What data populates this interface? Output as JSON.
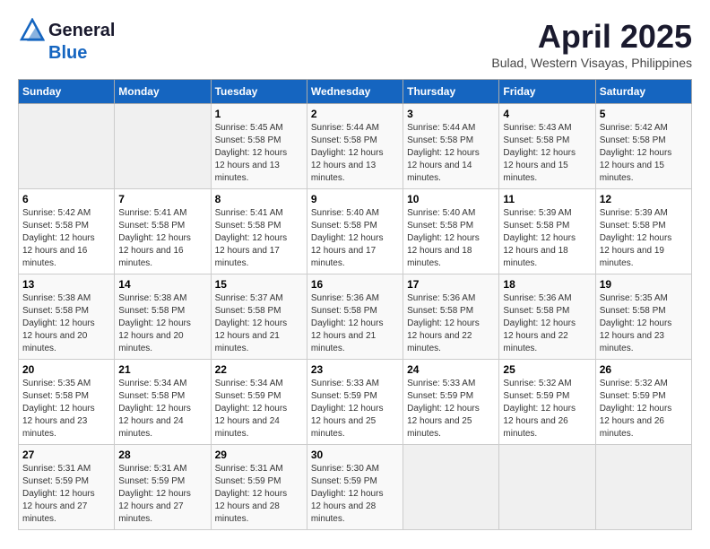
{
  "header": {
    "logo_general": "General",
    "logo_blue": "Blue",
    "month_title": "April 2025",
    "location": "Bulad, Western Visayas, Philippines"
  },
  "weekdays": [
    "Sunday",
    "Monday",
    "Tuesday",
    "Wednesday",
    "Thursday",
    "Friday",
    "Saturday"
  ],
  "weeks": [
    [
      {
        "day": "",
        "empty": true
      },
      {
        "day": "",
        "empty": true
      },
      {
        "day": "1",
        "sunrise": "5:45 AM",
        "sunset": "5:58 PM",
        "daylight": "12 hours and 13 minutes."
      },
      {
        "day": "2",
        "sunrise": "5:44 AM",
        "sunset": "5:58 PM",
        "daylight": "12 hours and 13 minutes."
      },
      {
        "day": "3",
        "sunrise": "5:44 AM",
        "sunset": "5:58 PM",
        "daylight": "12 hours and 14 minutes."
      },
      {
        "day": "4",
        "sunrise": "5:43 AM",
        "sunset": "5:58 PM",
        "daylight": "12 hours and 15 minutes."
      },
      {
        "day": "5",
        "sunrise": "5:42 AM",
        "sunset": "5:58 PM",
        "daylight": "12 hours and 15 minutes."
      }
    ],
    [
      {
        "day": "6",
        "sunrise": "5:42 AM",
        "sunset": "5:58 PM",
        "daylight": "12 hours and 16 minutes."
      },
      {
        "day": "7",
        "sunrise": "5:41 AM",
        "sunset": "5:58 PM",
        "daylight": "12 hours and 16 minutes."
      },
      {
        "day": "8",
        "sunrise": "5:41 AM",
        "sunset": "5:58 PM",
        "daylight": "12 hours and 17 minutes."
      },
      {
        "day": "9",
        "sunrise": "5:40 AM",
        "sunset": "5:58 PM",
        "daylight": "12 hours and 17 minutes."
      },
      {
        "day": "10",
        "sunrise": "5:40 AM",
        "sunset": "5:58 PM",
        "daylight": "12 hours and 18 minutes."
      },
      {
        "day": "11",
        "sunrise": "5:39 AM",
        "sunset": "5:58 PM",
        "daylight": "12 hours and 18 minutes."
      },
      {
        "day": "12",
        "sunrise": "5:39 AM",
        "sunset": "5:58 PM",
        "daylight": "12 hours and 19 minutes."
      }
    ],
    [
      {
        "day": "13",
        "sunrise": "5:38 AM",
        "sunset": "5:58 PM",
        "daylight": "12 hours and 20 minutes."
      },
      {
        "day": "14",
        "sunrise": "5:38 AM",
        "sunset": "5:58 PM",
        "daylight": "12 hours and 20 minutes."
      },
      {
        "day": "15",
        "sunrise": "5:37 AM",
        "sunset": "5:58 PM",
        "daylight": "12 hours and 21 minutes."
      },
      {
        "day": "16",
        "sunrise": "5:36 AM",
        "sunset": "5:58 PM",
        "daylight": "12 hours and 21 minutes."
      },
      {
        "day": "17",
        "sunrise": "5:36 AM",
        "sunset": "5:58 PM",
        "daylight": "12 hours and 22 minutes."
      },
      {
        "day": "18",
        "sunrise": "5:36 AM",
        "sunset": "5:58 PM",
        "daylight": "12 hours and 22 minutes."
      },
      {
        "day": "19",
        "sunrise": "5:35 AM",
        "sunset": "5:58 PM",
        "daylight": "12 hours and 23 minutes."
      }
    ],
    [
      {
        "day": "20",
        "sunrise": "5:35 AM",
        "sunset": "5:58 PM",
        "daylight": "12 hours and 23 minutes."
      },
      {
        "day": "21",
        "sunrise": "5:34 AM",
        "sunset": "5:58 PM",
        "daylight": "12 hours and 24 minutes."
      },
      {
        "day": "22",
        "sunrise": "5:34 AM",
        "sunset": "5:59 PM",
        "daylight": "12 hours and 24 minutes."
      },
      {
        "day": "23",
        "sunrise": "5:33 AM",
        "sunset": "5:59 PM",
        "daylight": "12 hours and 25 minutes."
      },
      {
        "day": "24",
        "sunrise": "5:33 AM",
        "sunset": "5:59 PM",
        "daylight": "12 hours and 25 minutes."
      },
      {
        "day": "25",
        "sunrise": "5:32 AM",
        "sunset": "5:59 PM",
        "daylight": "12 hours and 26 minutes."
      },
      {
        "day": "26",
        "sunrise": "5:32 AM",
        "sunset": "5:59 PM",
        "daylight": "12 hours and 26 minutes."
      }
    ],
    [
      {
        "day": "27",
        "sunrise": "5:31 AM",
        "sunset": "5:59 PM",
        "daylight": "12 hours and 27 minutes."
      },
      {
        "day": "28",
        "sunrise": "5:31 AM",
        "sunset": "5:59 PM",
        "daylight": "12 hours and 27 minutes."
      },
      {
        "day": "29",
        "sunrise": "5:31 AM",
        "sunset": "5:59 PM",
        "daylight": "12 hours and 28 minutes."
      },
      {
        "day": "30",
        "sunrise": "5:30 AM",
        "sunset": "5:59 PM",
        "daylight": "12 hours and 28 minutes."
      },
      {
        "day": "",
        "empty": true
      },
      {
        "day": "",
        "empty": true
      },
      {
        "day": "",
        "empty": true
      }
    ]
  ],
  "labels": {
    "sunrise": "Sunrise:",
    "sunset": "Sunset:",
    "daylight": "Daylight:"
  }
}
